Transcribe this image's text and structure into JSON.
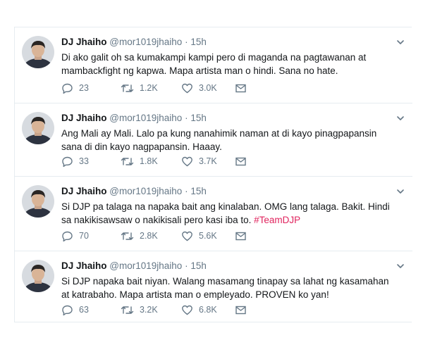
{
  "tweets": [
    {
      "name": "DJ Jhaiho",
      "handle": "@mor1019jhaiho",
      "dot": "·",
      "time": "15h",
      "text": "Di ako galit oh sa kumakampi kampi pero di maganda na pagtawanan at mambackfight ng kapwa. Mapa artista man o hindi. Sana no hate.",
      "replies": "23",
      "retweets": "1.2K",
      "likes": "3.0K"
    },
    {
      "name": "DJ Jhaiho",
      "handle": "@mor1019jhaiho",
      "dot": "·",
      "time": "15h",
      "text": "Ang Mali ay Mali. Lalo pa kung nanahimik naman at di kayo pinagpapansin sana di din kayo nagpapansin. Haaay.",
      "replies": "33",
      "retweets": "1.8K",
      "likes": "3.7K"
    },
    {
      "name": "DJ Jhaiho",
      "handle": "@mor1019jhaiho",
      "dot": "·",
      "time": "15h",
      "text": "Si DJP pa talaga na napaka bait ang kinalaban. OMG lang talaga. Bakit. Hindi sa nakikisawsaw o nakikisali pero kasi iba to. ",
      "hashtag": "#TeamDJP",
      "replies": "70",
      "retweets": "2.8K",
      "likes": "5.6K"
    },
    {
      "name": "DJ Jhaiho",
      "handle": "@mor1019jhaiho",
      "dot": "·",
      "time": "15h",
      "text": "Si DJP napaka bait niyan. Walang masamang tinapay sa lahat ng kasamahan at katrabaho. Mapa artista man o empleyado. PROVEN ko yan!",
      "replies": "63",
      "retweets": "3.2K",
      "likes": "6.8K"
    }
  ],
  "icons": {
    "reply": "reply-icon",
    "retweet": "retweet-icon",
    "like": "heart-icon",
    "dm": "envelope-icon",
    "caret": "chevron-down-icon"
  },
  "colors": {
    "text": "#14171a",
    "secondary": "#657786",
    "hashtag": "#e0245e",
    "border": "#e6ecf0"
  }
}
